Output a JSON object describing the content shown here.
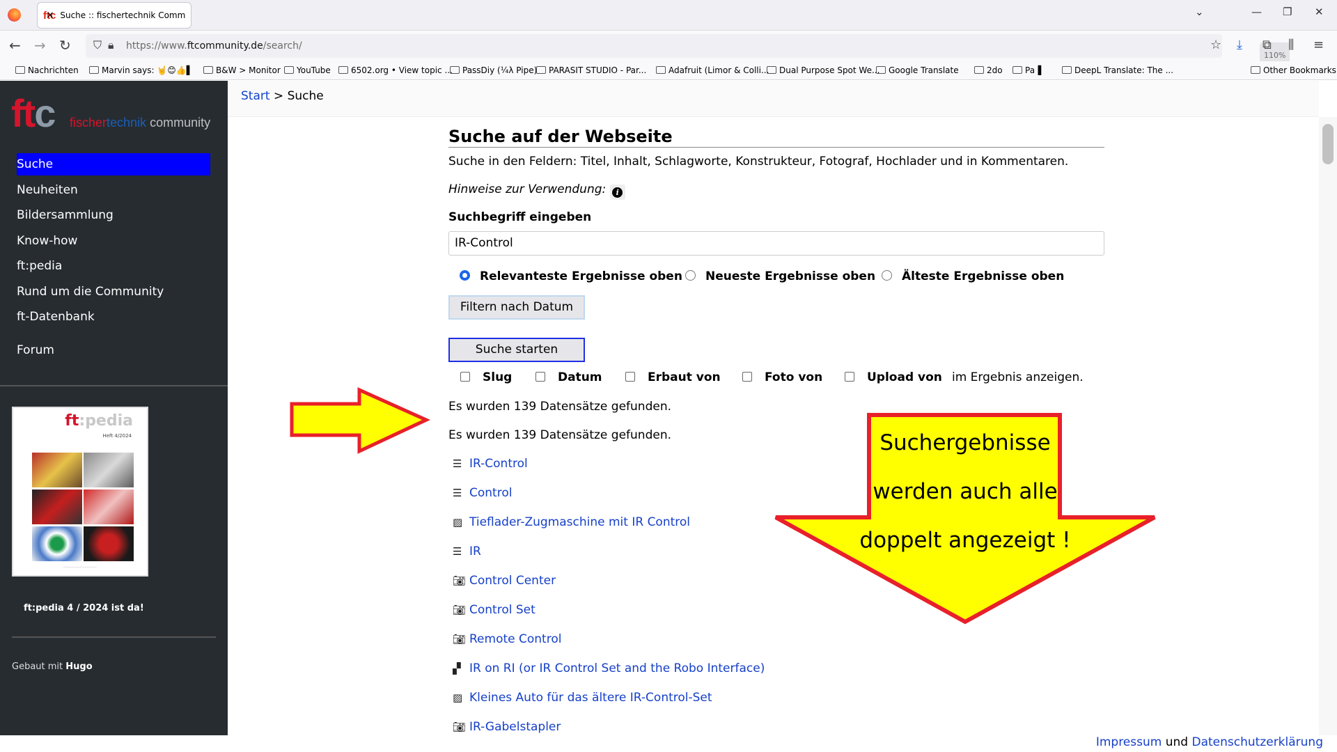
{
  "browser": {
    "tab_title": "Suche :: fischertechnik Commun",
    "tab_close": "×",
    "url_prefix": "https://www.",
    "url_domain": "ftcommunity.de",
    "url_path": "/search/",
    "zoom": "110%"
  },
  "bookmarks": [
    "Nachrichten",
    "Marvin says: 🤘😊👍▌",
    "B&W > Monitor",
    "YouTube",
    "6502.org • View topic ...",
    "PassDiy (¼λ Pipe)",
    "PARASIT STUDIO - Par...",
    "Adafruit (Limor & Colli...",
    "Dual Purpose Spot We...",
    "Google Translate",
    "2do",
    "Pa▐",
    "DeepL Translate: The ...",
    "Other Bookmarks"
  ],
  "sidebar": {
    "logo_text": "ftc",
    "logo_sub_a": "fischer",
    "logo_sub_b": "technik",
    "logo_sub_c": " community",
    "items": [
      "Suche",
      "Neuheiten",
      "Bildersammlung",
      "Know-how",
      "ft:pedia",
      "Rund um die Community",
      "ft-Datenbank",
      "Forum"
    ],
    "cover_title_a": "ft",
    "cover_title_b": ":pedia",
    "cover_issue": "Heft 4/2024",
    "cover_caption": "ft:pedia 4 / 2024 ist da!",
    "built_with": "Gebaut mit ",
    "built_with_bold": "Hugo"
  },
  "breadcrumb": {
    "start": "Start",
    "sep": " > ",
    "current": "Suche"
  },
  "search": {
    "heading": "Suche auf der Webseite",
    "fields_text": "Suche in den Feldern: Titel, Inhalt, Schlagworte, Konstrukteur, Fotograf, Hochlader und in Kommentaren.",
    "hint_label": "Hinweise zur Verwendung:",
    "term_label": "Suchbegriff eingeben",
    "term_value": "IR-Control",
    "sort_options": [
      "Relevanteste Ergebnisse oben",
      "Neueste Ergebnisse oben",
      "Älteste Ergebnisse oben"
    ],
    "selected_sort": 0,
    "filter_button": "Filtern nach Datum",
    "start_button": "Suche starten",
    "show_options": [
      "Slug",
      "Datum",
      "Erbaut von",
      "Foto von",
      "Upload von"
    ],
    "show_suffix": "im Ergebnis anzeigen.",
    "count_line_1": "Es wurden 139 Datensätze gefunden.",
    "count_line_2": "Es wurden 139 Datensätze gefunden."
  },
  "results": [
    {
      "icon": "list-icon",
      "title": "IR-Control"
    },
    {
      "icon": "list-icon",
      "title": "Control"
    },
    {
      "icon": "gallery-icon",
      "title": "Tieflader-Zugmaschine mit IR Control"
    },
    {
      "icon": "list-icon",
      "title": "IR"
    },
    {
      "icon": "camera-icon",
      "title": "Control Center"
    },
    {
      "icon": "camera-icon",
      "title": "Control Set"
    },
    {
      "icon": "camera-icon",
      "title": "Remote Control"
    },
    {
      "icon": "reader-icon",
      "title": "IR on RI (or IR Control Set and the Robo Interface)"
    },
    {
      "icon": "gallery-icon",
      "title": "Kleines Auto für das ältere IR-Control-Set"
    },
    {
      "icon": "camera-icon",
      "title": "IR-Gabelstapler"
    }
  ],
  "annotation": {
    "line1": "Suchergebnisse",
    "line2": "werden auch alle",
    "line3": "doppelt angezeigt !",
    "fill": "#ffff00",
    "stroke": "#e8202a"
  },
  "footer": {
    "impressum": "Impressum",
    "und": " und ",
    "privacy": "Datenschutzerklärung"
  }
}
